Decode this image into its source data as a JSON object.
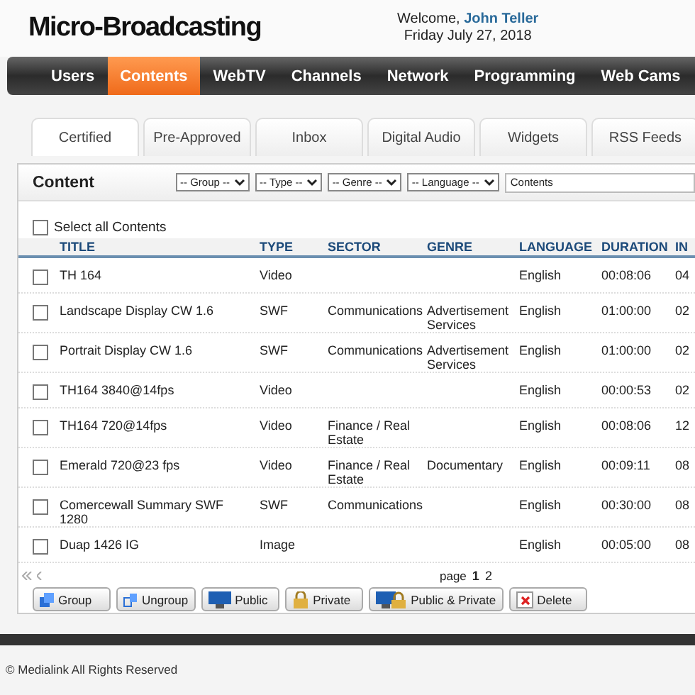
{
  "header": {
    "logo": "Micro-Broadcasting",
    "welcome": "Welcome,",
    "user": "John Teller",
    "date": "Friday July 27, 2018"
  },
  "nav": [
    {
      "label": "Users",
      "selected": false
    },
    {
      "label": "Contents",
      "selected": true
    },
    {
      "label": "WebTV",
      "selected": false
    },
    {
      "label": "Channels",
      "selected": false
    },
    {
      "label": "Network",
      "selected": false
    },
    {
      "label": "Programming",
      "selected": false
    },
    {
      "label": "Web Cams",
      "selected": false
    }
  ],
  "tabs": [
    {
      "label": "Certified",
      "selected": true
    },
    {
      "label": "Pre-Approved",
      "selected": false
    },
    {
      "label": "Inbox",
      "selected": false
    },
    {
      "label": "Digital Audio",
      "selected": false
    },
    {
      "label": "Widgets",
      "selected": false
    },
    {
      "label": "RSS Feeds",
      "selected": false
    }
  ],
  "panel": {
    "title": "Content",
    "filters": [
      "-- Group --",
      "-- Type --",
      "-- Genre --",
      "-- Language --"
    ],
    "search": {
      "value": "Contents"
    },
    "select_all": {
      "label": "Select all Contents",
      "checked": false
    }
  },
  "table": {
    "columns": [
      "TITLE",
      "TYPE",
      "SECTOR",
      "GENRE",
      "LANGUAGE",
      "DURATION",
      "IN"
    ],
    "rows": [
      {
        "checked": false,
        "cells": [
          "TH 164",
          "Video",
          "",
          "",
          "English",
          "00:08:06",
          "04"
        ]
      },
      {
        "checked": false,
        "cells": [
          "Landscape Display CW 1.6",
          "SWF",
          "Communications",
          "Advertisement Services",
          "English",
          "01:00:00",
          "02"
        ]
      },
      {
        "checked": false,
        "cells": [
          "Portrait Display CW 1.6",
          "SWF",
          "Communications",
          "Advertisement Services",
          "English",
          "01:00:00",
          "02"
        ]
      },
      {
        "checked": false,
        "cells": [
          "TH164 3840@14fps",
          "Video",
          "",
          "",
          "English",
          "00:00:53",
          "02"
        ]
      },
      {
        "checked": false,
        "cells": [
          "TH164 720@14fps",
          "Video",
          "Finance / Real Estate",
          "",
          "English",
          "00:08:06",
          "12"
        ]
      },
      {
        "checked": false,
        "cells": [
          "Emerald 720@23 fps",
          "Video",
          "Finance / Real Estate",
          "Documentary",
          "English",
          "00:09:11",
          "08"
        ]
      },
      {
        "checked": false,
        "cells": [
          "Comercewall Summary SWF 1280",
          "SWF",
          "Communications",
          "",
          "English",
          "00:30:00",
          "08"
        ]
      },
      {
        "checked": false,
        "cells": [
          "Duap 1426 IG",
          "Image",
          "",
          "",
          "English",
          "00:05:00",
          "08"
        ]
      }
    ]
  },
  "pager": {
    "label": "page",
    "pages": [
      {
        "label": "1",
        "selected": true
      },
      {
        "label": "2",
        "selected": false
      }
    ]
  },
  "actions": [
    {
      "kind": "group",
      "label": "Group"
    },
    {
      "kind": "ungroup",
      "label": "Ungroup"
    },
    {
      "kind": "public",
      "label": "Public"
    },
    {
      "kind": "private",
      "label": "Private"
    },
    {
      "kind": "both",
      "label": "Public & Private"
    },
    {
      "kind": "delete",
      "label": "Delete"
    }
  ],
  "footer": "© Medialink All Rights Reserved"
}
